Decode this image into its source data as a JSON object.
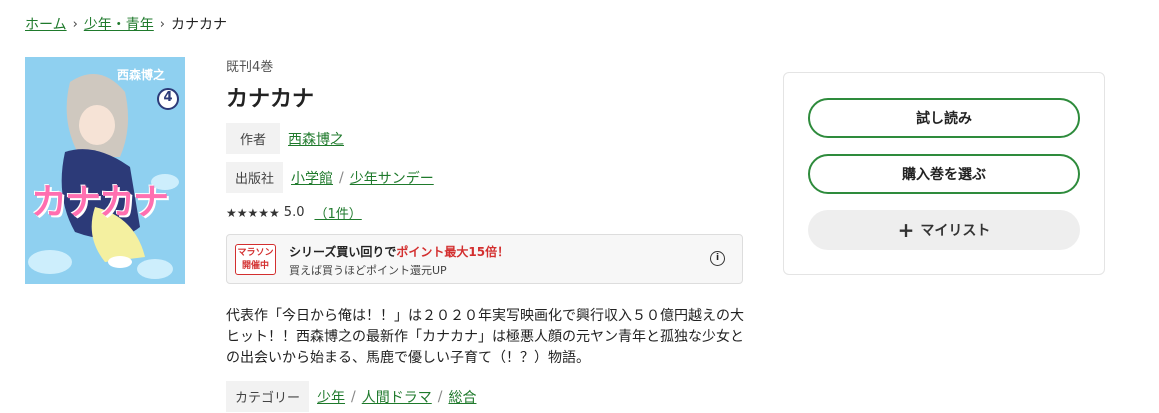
{
  "breadcrumb": {
    "home": "ホーム",
    "category": "少年・青年",
    "current": "カナカナ"
  },
  "cover": {
    "author_text": "西森博之",
    "volume": "4",
    "title_art": "カナカナ",
    "bg_color": "#8fd0f0"
  },
  "book": {
    "kikan": "既刊4巻",
    "title": "カナカナ",
    "author_label": "作者",
    "author": "西森博之",
    "publisher_label": "出版社",
    "publisher": "小学館",
    "label": "少年サンデー",
    "stars": "★★★★★",
    "rating": "5.0",
    "review_count": "（1件）"
  },
  "campaign": {
    "badge_line1": "マラソン",
    "badge_line2": "開催中",
    "text_a": "シリーズ買い回りで",
    "text_b": "ポイント最大15倍！",
    "sub": "買えば買うほどポイント還元UP",
    "info_icon": "i"
  },
  "description": "代表作「今日から俺は！！」は２０２０年実写映画化で興行収入５０億円越えの大ヒット！！西森博之の最新作「カナカナ」は極悪人顔の元ヤン青年と孤独な少女との出会いから始まる、馬鹿で優しい子育て（！？）物語。",
  "category": {
    "label": "カテゴリー",
    "items": [
      "少年",
      "人間ドラマ",
      "総合"
    ]
  },
  "actions": {
    "trial": "試し読み",
    "buy": "購入巻を選ぶ",
    "mylist": "マイリスト",
    "plus": "+"
  },
  "colors": {
    "accent_green": "#2e8b3c",
    "link_green": "#1f7a2c",
    "campaign_red": "#d32f2f"
  }
}
